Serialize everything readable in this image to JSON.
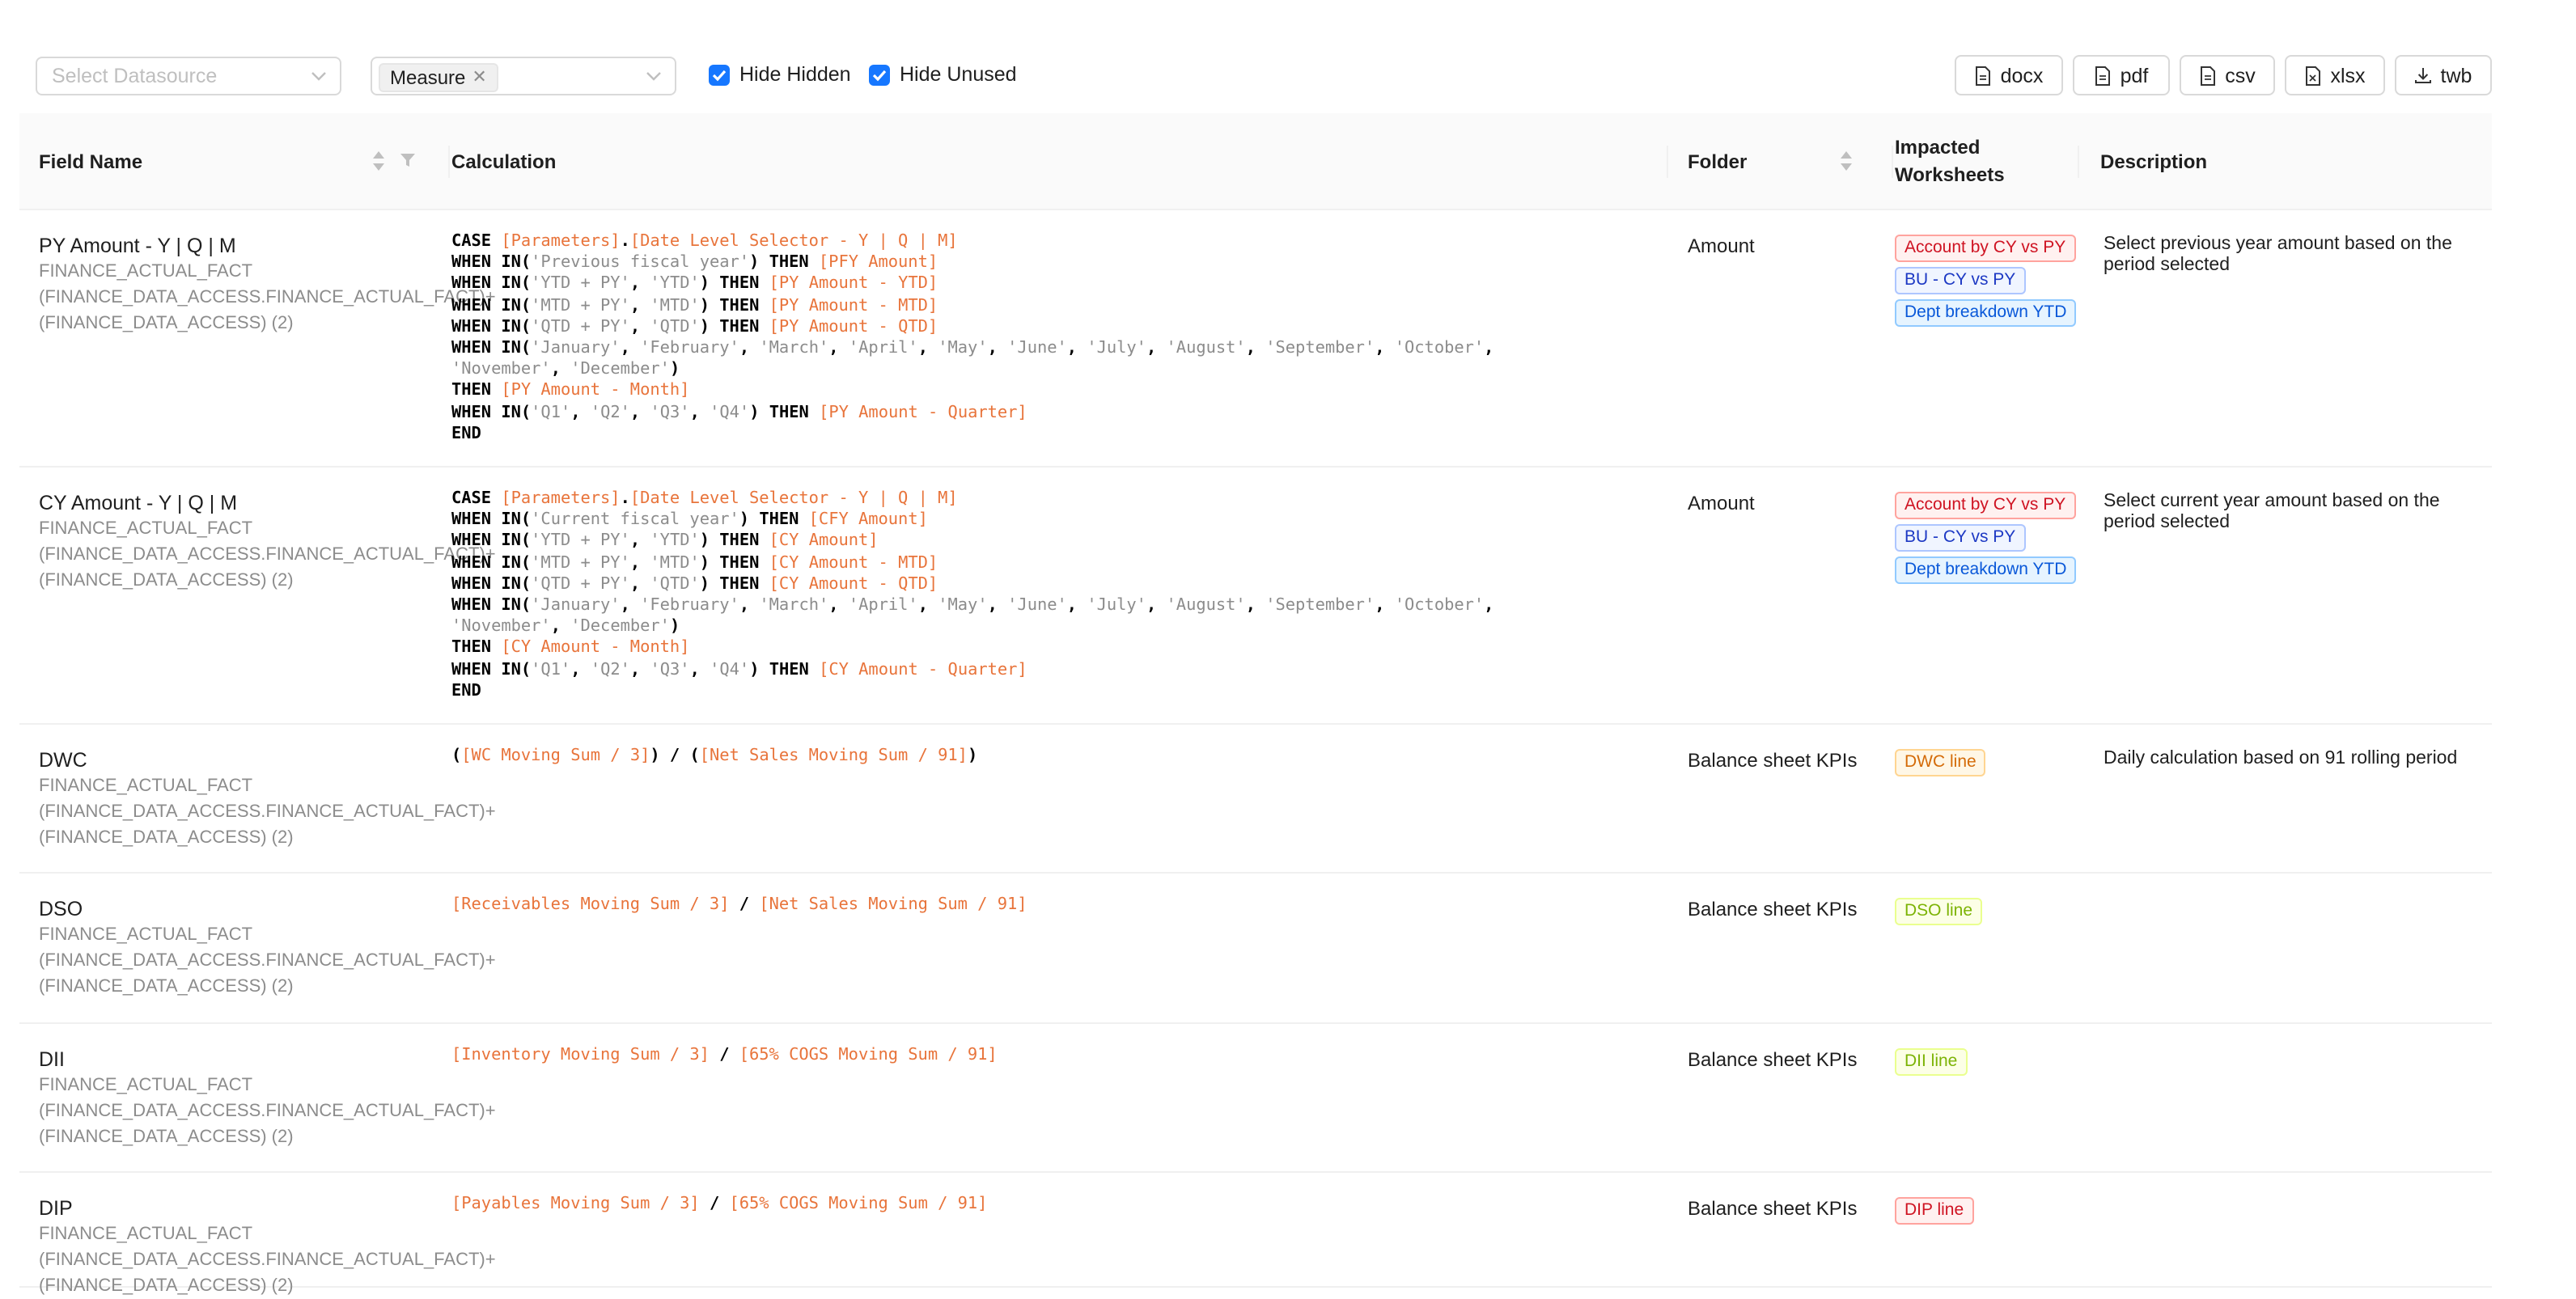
{
  "toolbar": {
    "datasource_placeholder": "Select Datasource",
    "type_tag": "Measure",
    "hide_hidden_label": "Hide Hidden",
    "hide_unused_label": "Hide Unused",
    "hide_hidden_checked": true,
    "hide_unused_checked": true,
    "export_buttons": [
      "docx",
      "pdf",
      "csv",
      "xlsx",
      "twb"
    ]
  },
  "table": {
    "headers": {
      "field_name": "Field Name",
      "calculation": "Calculation",
      "folder": "Folder",
      "impacted_line1": "Impacted",
      "impacted_line2": "Worksheets",
      "description": "Description"
    },
    "rows": [
      {
        "name": "PY Amount - Y | Q | M",
        "source": "FINANCE_ACTUAL_FACT (FINANCE_DATA_ACCESS.FINANCE_ACTUAL_FACT)+ (FINANCE_DATA_ACCESS) (2)",
        "calc_lines": [
          [
            [
              "kw",
              "CASE "
            ],
            [
              "ref",
              "[Parameters]"
            ],
            [
              "kw",
              "."
            ],
            [
              "ref",
              "[Date Level Selector - Y | Q | M]"
            ]
          ],
          [
            [
              "kw",
              "WHEN IN("
            ],
            [
              "str",
              "'Previous fiscal year'"
            ],
            [
              "kw",
              ") THEN "
            ],
            [
              "ref",
              "[PFY Amount]"
            ]
          ],
          [
            [
              "kw",
              "WHEN IN("
            ],
            [
              "str",
              "'YTD + PY'"
            ],
            [
              "kw",
              ", "
            ],
            [
              "str",
              "'YTD'"
            ],
            [
              "kw",
              ") THEN "
            ],
            [
              "ref",
              "[PY Amount - YTD]"
            ]
          ],
          [
            [
              "kw",
              "WHEN IN("
            ],
            [
              "str",
              "'MTD + PY'"
            ],
            [
              "kw",
              ", "
            ],
            [
              "str",
              "'MTD'"
            ],
            [
              "kw",
              ") THEN "
            ],
            [
              "ref",
              "[PY Amount - MTD]"
            ]
          ],
          [
            [
              "kw",
              "WHEN IN("
            ],
            [
              "str",
              "'QTD + PY'"
            ],
            [
              "kw",
              ", "
            ],
            [
              "str",
              "'QTD'"
            ],
            [
              "kw",
              ") THEN "
            ],
            [
              "ref",
              "[PY Amount - QTD]"
            ]
          ],
          [
            [
              "kw",
              "WHEN IN("
            ],
            [
              "str",
              "'January'"
            ],
            [
              "kw",
              ", "
            ],
            [
              "str",
              "'February'"
            ],
            [
              "kw",
              ", "
            ],
            [
              "str",
              "'March'"
            ],
            [
              "kw",
              ", "
            ],
            [
              "str",
              "'April'"
            ],
            [
              "kw",
              ", "
            ],
            [
              "str",
              "'May'"
            ],
            [
              "kw",
              ", "
            ],
            [
              "str",
              "'June'"
            ],
            [
              "kw",
              ", "
            ],
            [
              "str",
              "'July'"
            ],
            [
              "kw",
              ", "
            ],
            [
              "str",
              "'August'"
            ],
            [
              "kw",
              ", "
            ],
            [
              "str",
              "'September'"
            ],
            [
              "kw",
              ", "
            ],
            [
              "str",
              "'October'"
            ],
            [
              "kw",
              ","
            ]
          ],
          [
            [
              "str",
              "'November'"
            ],
            [
              "kw",
              ", "
            ],
            [
              "str",
              "'December'"
            ],
            [
              "kw",
              ")"
            ]
          ],
          [
            [
              "kw",
              "THEN "
            ],
            [
              "ref",
              "[PY Amount - Month]"
            ]
          ],
          [
            [
              "kw",
              "WHEN IN("
            ],
            [
              "str",
              "'Q1'"
            ],
            [
              "kw",
              ", "
            ],
            [
              "str",
              "'Q2'"
            ],
            [
              "kw",
              ", "
            ],
            [
              "str",
              "'Q3'"
            ],
            [
              "kw",
              ", "
            ],
            [
              "str",
              "'Q4'"
            ],
            [
              "kw",
              ") THEN "
            ],
            [
              "ref",
              "[PY Amount - Quarter]"
            ]
          ],
          [
            [
              "kw",
              "END"
            ]
          ]
        ],
        "folder": "Amount",
        "worksheets": [
          {
            "label": "Account by CY vs PY",
            "color": "red"
          },
          {
            "label": "BU - CY vs PY",
            "color": "blue"
          },
          {
            "label": "Dept breakdown YTD",
            "color": "lblue"
          }
        ],
        "description": "Select previous year amount based on the period selected"
      },
      {
        "name": "CY Amount - Y | Q | M",
        "source": "FINANCE_ACTUAL_FACT (FINANCE_DATA_ACCESS.FINANCE_ACTUAL_FACT)+ (FINANCE_DATA_ACCESS) (2)",
        "calc_lines": [
          [
            [
              "kw",
              "CASE "
            ],
            [
              "ref",
              "[Parameters]"
            ],
            [
              "kw",
              "."
            ],
            [
              "ref",
              "[Date Level Selector - Y | Q | M]"
            ]
          ],
          [
            [
              "kw",
              "WHEN IN("
            ],
            [
              "str",
              "'Current fiscal year'"
            ],
            [
              "kw",
              ") THEN "
            ],
            [
              "ref",
              "[CFY Amount]"
            ]
          ],
          [
            [
              "kw",
              "WHEN IN("
            ],
            [
              "str",
              "'YTD + PY'"
            ],
            [
              "kw",
              ", "
            ],
            [
              "str",
              "'YTD'"
            ],
            [
              "kw",
              ") THEN "
            ],
            [
              "ref",
              "[CY Amount]"
            ]
          ],
          [
            [
              "kw",
              "WHEN IN("
            ],
            [
              "str",
              "'MTD + PY'"
            ],
            [
              "kw",
              ", "
            ],
            [
              "str",
              "'MTD'"
            ],
            [
              "kw",
              ") THEN "
            ],
            [
              "ref",
              "[CY Amount - MTD]"
            ]
          ],
          [
            [
              "kw",
              "WHEN IN("
            ],
            [
              "str",
              "'QTD + PY'"
            ],
            [
              "kw",
              ", "
            ],
            [
              "str",
              "'QTD'"
            ],
            [
              "kw",
              ") THEN "
            ],
            [
              "ref",
              "[CY Amount - QTD]"
            ]
          ],
          [
            [
              "kw",
              "WHEN IN("
            ],
            [
              "str",
              "'January'"
            ],
            [
              "kw",
              ", "
            ],
            [
              "str",
              "'February'"
            ],
            [
              "kw",
              ", "
            ],
            [
              "str",
              "'March'"
            ],
            [
              "kw",
              ", "
            ],
            [
              "str",
              "'April'"
            ],
            [
              "kw",
              ", "
            ],
            [
              "str",
              "'May'"
            ],
            [
              "kw",
              ", "
            ],
            [
              "str",
              "'June'"
            ],
            [
              "kw",
              ", "
            ],
            [
              "str",
              "'July'"
            ],
            [
              "kw",
              ", "
            ],
            [
              "str",
              "'August'"
            ],
            [
              "kw",
              ", "
            ],
            [
              "str",
              "'September'"
            ],
            [
              "kw",
              ", "
            ],
            [
              "str",
              "'October'"
            ],
            [
              "kw",
              ","
            ]
          ],
          [
            [
              "str",
              "'November'"
            ],
            [
              "kw",
              ", "
            ],
            [
              "str",
              "'December'"
            ],
            [
              "kw",
              ")"
            ]
          ],
          [
            [
              "kw",
              "THEN "
            ],
            [
              "ref",
              "[CY Amount - Month]"
            ]
          ],
          [
            [
              "kw",
              "WHEN IN("
            ],
            [
              "str",
              "'Q1'"
            ],
            [
              "kw",
              ", "
            ],
            [
              "str",
              "'Q2'"
            ],
            [
              "kw",
              ", "
            ],
            [
              "str",
              "'Q3'"
            ],
            [
              "kw",
              ", "
            ],
            [
              "str",
              "'Q4'"
            ],
            [
              "kw",
              ") THEN "
            ],
            [
              "ref",
              "[CY Amount - Quarter]"
            ]
          ],
          [
            [
              "kw",
              "END"
            ]
          ]
        ],
        "folder": "Amount",
        "worksheets": [
          {
            "label": "Account by CY vs PY",
            "color": "red"
          },
          {
            "label": "BU - CY vs PY",
            "color": "blue"
          },
          {
            "label": "Dept breakdown YTD",
            "color": "lblue"
          }
        ],
        "description": "Select current year amount based on the period selected"
      },
      {
        "name": "DWC",
        "source": "FINANCE_ACTUAL_FACT (FINANCE_DATA_ACCESS.FINANCE_ACTUAL_FACT)+ (FINANCE_DATA_ACCESS) (2)",
        "calc_lines": [
          [
            [
              "kw",
              "("
            ],
            [
              "ref",
              "[WC Moving Sum / 3]"
            ],
            [
              "kw",
              ") / ("
            ],
            [
              "ref",
              "[Net Sales Moving Sum / 91]"
            ],
            [
              "kw",
              ")"
            ]
          ]
        ],
        "folder": "Balance sheet KPIs",
        "worksheets": [
          {
            "label": "DWC line",
            "color": "orange"
          }
        ],
        "description": "Daily calculation based on 91 rolling period"
      },
      {
        "name": "DSO",
        "source": "FINANCE_ACTUAL_FACT (FINANCE_DATA_ACCESS.FINANCE_ACTUAL_FACT)+ (FINANCE_DATA_ACCESS) (2)",
        "calc_lines": [
          [
            [
              "ref",
              "[Receivables Moving Sum / 3]"
            ],
            [
              "kw",
              " / "
            ],
            [
              "ref",
              "[Net Sales Moving Sum / 91]"
            ]
          ]
        ],
        "folder": "Balance sheet KPIs",
        "worksheets": [
          {
            "label": "DSO line",
            "color": "lime"
          }
        ],
        "description": ""
      },
      {
        "name": "DII",
        "source": "FINANCE_ACTUAL_FACT (FINANCE_DATA_ACCESS.FINANCE_ACTUAL_FACT)+ (FINANCE_DATA_ACCESS) (2)",
        "calc_lines": [
          [
            [
              "ref",
              "[Inventory Moving Sum / 3]"
            ],
            [
              "kw",
              " / "
            ],
            [
              "ref",
              "[65% COGS Moving Sum / 91]"
            ]
          ]
        ],
        "folder": "Balance sheet KPIs",
        "worksheets": [
          {
            "label": "DII line",
            "color": "lime"
          }
        ],
        "description": ""
      },
      {
        "name": "DIP",
        "source": "FINANCE_ACTUAL_FACT (FINANCE_DATA_ACCESS.FINANCE_ACTUAL_FACT)+ (FINANCE_DATA_ACCESS) (2)",
        "calc_lines": [
          [
            [
              "ref",
              "[Payables Moving Sum / 3]"
            ],
            [
              "kw",
              " / "
            ],
            [
              "ref",
              "[65% COGS Moving Sum / 91]"
            ]
          ]
        ],
        "folder": "Balance sheet KPIs",
        "worksheets": [
          {
            "label": "DIP line",
            "color": "red"
          }
        ],
        "description": ""
      }
    ]
  }
}
